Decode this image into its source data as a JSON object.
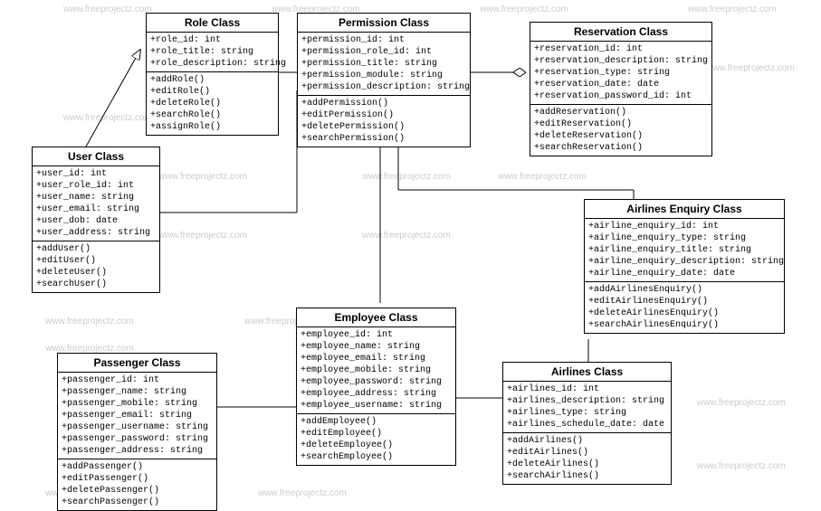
{
  "watermark_text": "www.freeprojectz.com",
  "classes": {
    "role": {
      "title": "Role Class",
      "attrs": [
        "+role_id: int",
        "+role_title: string",
        "+role_description: string"
      ],
      "ops": [
        "+addRole()",
        "+editRole()",
        "+deleteRole()",
        "+searchRole()",
        "+assignRole()"
      ]
    },
    "permission": {
      "title": "Permission Class",
      "attrs": [
        "+permission_id: int",
        "+permission_role_id: int",
        "+permission_title: string",
        "+permission_module: string",
        "+permission_description: string"
      ],
      "ops": [
        "+addPermission()",
        "+editPermission()",
        "+deletePermission()",
        "+searchPermission()"
      ]
    },
    "reservation": {
      "title": "Reservation Class",
      "attrs": [
        "+reservation_id: int",
        "+reservation_description: string",
        "+reservation_type: string",
        "+reservation_date: date",
        "+reservation_password_id: int"
      ],
      "ops": [
        "+addReservation()",
        "+editReservation()",
        "+deleteReservation()",
        "+searchReservation()"
      ]
    },
    "user": {
      "title": "User Class",
      "attrs": [
        "+user_id: int",
        "+user_role_id: int",
        "+user_name: string",
        "+user_email: string",
        "+user_dob: date",
        "+user_address: string"
      ],
      "ops": [
        "+addUser()",
        "+editUser()",
        "+deleteUser()",
        "+searchUser()"
      ]
    },
    "enquiry": {
      "title": "Airlines Enquiry Class",
      "attrs": [
        "+airline_enquiry_id: int",
        "+airline_enquiry_type: string",
        "+airline_enquiry_title: string",
        "+airline_enquiry_description: string",
        "+airline_enquiry_date: date"
      ],
      "ops": [
        "+addAirlinesEnquiry()",
        "+editAirlinesEnquiry()",
        "+deleteAirlinesEnquiry()",
        "+searchAirlinesEnquiry()"
      ]
    },
    "passenger": {
      "title": "Passenger Class",
      "attrs": [
        "+passenger_id: int",
        "+passenger_name: string",
        "+passenger_mobile: string",
        "+passenger_email: string",
        "+passenger_username: string",
        "+passenger_password: string",
        "+passenger_address: string"
      ],
      "ops": [
        "+addPassenger()",
        "+editPassenger()",
        "+deletePassenger()",
        "+searchPassenger()"
      ]
    },
    "employee": {
      "title": "Employee Class",
      "attrs": [
        "+employee_id: int",
        "+employee_name: string",
        "+employee_email: string",
        "+employee_mobile: string",
        "+employee_password: string",
        "+employee_address: string",
        "+employee_username: string"
      ],
      "ops": [
        "+addEmployee()",
        "+editEmployee()",
        "+deleteEmployee()",
        "+searchEmployee()"
      ]
    },
    "airlines": {
      "title": "Airlines Class",
      "attrs": [
        "+airlines_id: int",
        "+airlines_description: string",
        "+airlines_type: string",
        "+airlines_schedule_date: date"
      ],
      "ops": [
        "+addAirlines()",
        "+editAirlines()",
        "+deleteAirlines()",
        "+searchAirlines()"
      ]
    }
  }
}
